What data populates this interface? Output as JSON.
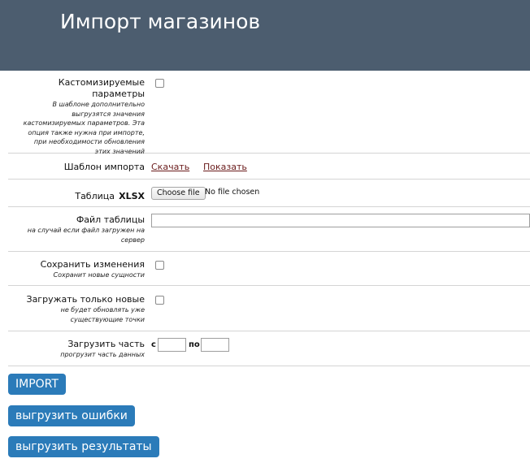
{
  "header": {
    "title": "Импорт магазинов",
    "bg_color": "#4c5d6f"
  },
  "form": {
    "custom_params": {
      "label": "Кастомизируемые параметры",
      "hint_lines": [
        "В шаблоне дополнительно",
        "выгрузятся значения",
        "кастомизируемых параметров. Эта",
        "опция также нужна при импорте,",
        "при необходимости обновления",
        "этих значений"
      ],
      "checked": false
    },
    "template": {
      "label": "Шаблон импорта",
      "download_link": "Скачать",
      "show_link": "Показать"
    },
    "table": {
      "label_prefix": "Таблица",
      "label_bold": "XLSX",
      "choose_button": "Choose file",
      "status": "No file chosen"
    },
    "table_file": {
      "label": "Файл таблицы",
      "hint_lines": [
        "на случай если файл загружен на",
        "сервер"
      ],
      "value": ""
    },
    "save_changes": {
      "label": "Сохранить изменения",
      "hint_lines": [
        "Сохранит новые сущности"
      ],
      "checked": false
    },
    "only_new": {
      "label": "Загружать только новые",
      "hint_lines": [
        "не будет обновлять уже",
        "существующие точки"
      ],
      "checked": false
    },
    "part": {
      "label": "Загрузить часть",
      "hint_lines": [
        "прогрузит часть данных"
      ],
      "from_label": "с",
      "to_label": "по",
      "from_value": "",
      "to_value": ""
    }
  },
  "buttons": {
    "import": "IMPORT",
    "export_errors": "выгрузить ошибки",
    "export_results": "выгрузить результаты",
    "color": "#2b7bb9"
  }
}
